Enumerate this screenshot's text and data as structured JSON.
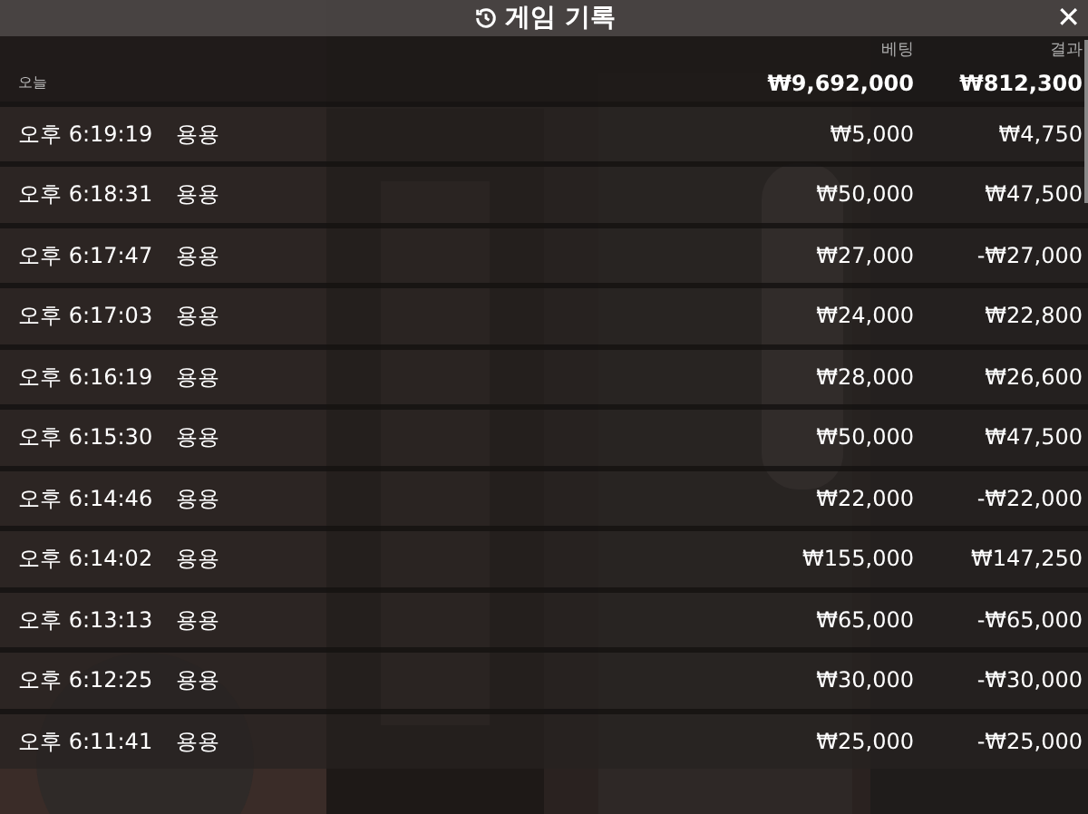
{
  "header": {
    "title": "게임 기록",
    "close": "✕"
  },
  "columns": {
    "bet": "베팅",
    "result": "결과"
  },
  "day": {
    "label": "오늘",
    "bet_total": "₩9,692,000",
    "result_total": "₩812,300"
  },
  "rows": [
    {
      "time": "오후 6:19:19",
      "game": "용용",
      "bet": "₩5,000",
      "result": "₩4,750"
    },
    {
      "time": "오후 6:18:31",
      "game": "용용",
      "bet": "₩50,000",
      "result": "₩47,500"
    },
    {
      "time": "오후 6:17:47",
      "game": "용용",
      "bet": "₩27,000",
      "result": "-₩27,000"
    },
    {
      "time": "오후 6:17:03",
      "game": "용용",
      "bet": "₩24,000",
      "result": "₩22,800"
    },
    {
      "time": "오후 6:16:19",
      "game": "용용",
      "bet": "₩28,000",
      "result": "₩26,600"
    },
    {
      "time": "오후 6:15:30",
      "game": "용용",
      "bet": "₩50,000",
      "result": "₩47,500"
    },
    {
      "time": "오후 6:14:46",
      "game": "용용",
      "bet": "₩22,000",
      "result": "-₩22,000"
    },
    {
      "time": "오후 6:14:02",
      "game": "용용",
      "bet": "₩155,000",
      "result": "₩147,250"
    },
    {
      "time": "오후 6:13:13",
      "game": "용용",
      "bet": "₩65,000",
      "result": "-₩65,000"
    },
    {
      "time": "오후 6:12:25",
      "game": "용용",
      "bet": "₩30,000",
      "result": "-₩30,000"
    },
    {
      "time": "오후 6:11:41",
      "game": "용용",
      "bet": "₩25,000",
      "result": "-₩25,000"
    }
  ]
}
